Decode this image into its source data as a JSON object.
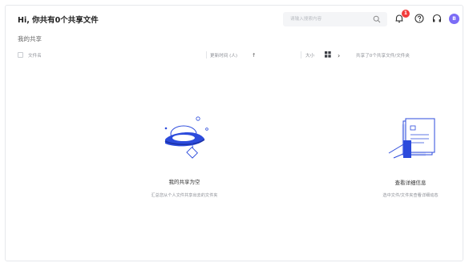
{
  "header": {
    "title": "Hi, 你共有0个共享文件",
    "search_placeholder": "请输入搜索内容",
    "notification_count": "1",
    "avatar_initial": "B"
  },
  "breadcrumb": "我的共享",
  "columns": {
    "name": "文件名",
    "updated": "更新时间 (人)",
    "size": "大小",
    "share_info": "共享了0个共享文件/文件夹"
  },
  "empty_left": {
    "title": "我的共享为空",
    "subtitle": "汇总您从个人文件共享出去的文件夹"
  },
  "empty_right": {
    "title": "查看详细信息",
    "subtitle": "选中文件/文件夹查看详细动态"
  },
  "colors": {
    "accent": "#2c4bdc",
    "avatar": "#7b6cf6",
    "badge": "#f23c3c"
  }
}
